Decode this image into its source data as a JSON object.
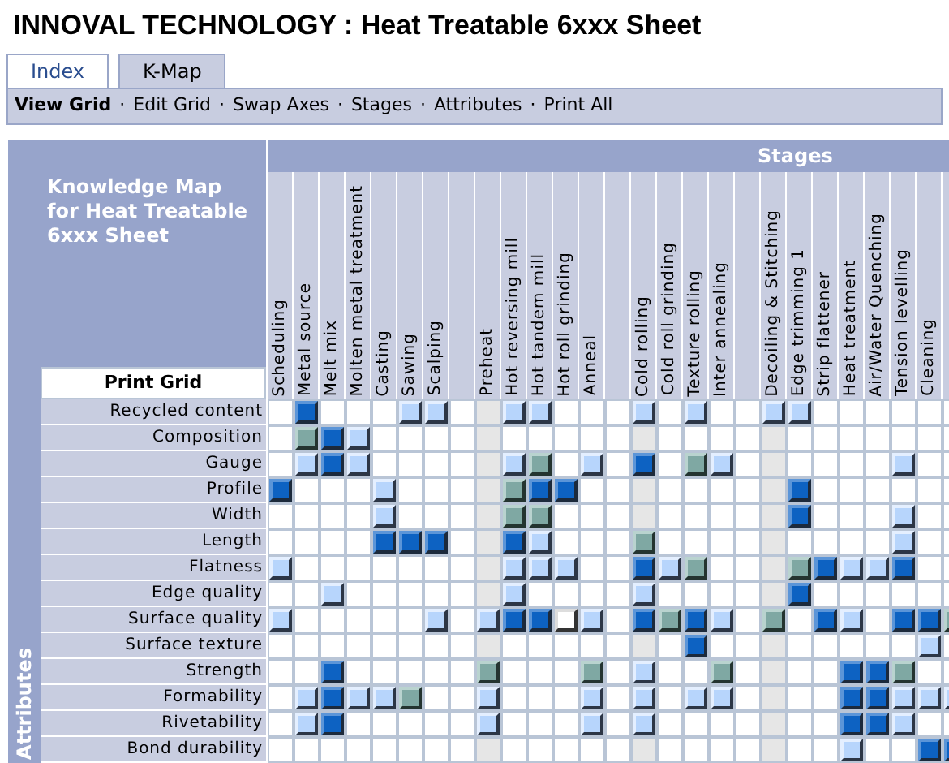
{
  "title": "INNOVAL TECHNOLOGY : Heat Treatable 6xxx Sheet",
  "tabs": [
    {
      "label": "Index",
      "selected": false
    },
    {
      "label": "K-Map",
      "selected": true
    }
  ],
  "toolbar": [
    {
      "label": "View Grid",
      "selected": true
    },
    {
      "label": "Edit Grid",
      "selected": false
    },
    {
      "label": "Swap Axes",
      "selected": false
    },
    {
      "label": "Stages",
      "selected": false
    },
    {
      "label": "Attributes",
      "selected": false
    },
    {
      "label": "Print All",
      "selected": false
    }
  ],
  "separator": "·",
  "grid_title": "Knowledge Map for Heat Treatable 6xxx Sheet",
  "stages_heading": "Stages",
  "attributes_heading": "Attributes",
  "print_button": "Print Grid",
  "columns": [
    {
      "label": "Scheduling",
      "shaded": false
    },
    {
      "label": "Metal source",
      "shaded": false
    },
    {
      "label": "Melt mix",
      "shaded": false
    },
    {
      "label": "Molten metal treatment",
      "shaded": false
    },
    {
      "label": "Casting",
      "shaded": false
    },
    {
      "label": "Sawing",
      "shaded": false
    },
    {
      "label": "Scalping",
      "shaded": false
    },
    {
      "shaded": false
    },
    {
      "label": "Preheat",
      "shaded": true
    },
    {
      "label": "Hot reversing mill",
      "shaded": false
    },
    {
      "label": "Hot tandem mill",
      "shaded": false
    },
    {
      "label": "Hot roll grinding",
      "shaded": false
    },
    {
      "label": "Anneal",
      "shaded": false
    },
    {
      "shaded": false
    },
    {
      "label": "Cold rolling",
      "shaded": true
    },
    {
      "label": "Cold roll grinding",
      "shaded": false
    },
    {
      "label": "Texture rolling",
      "shaded": false
    },
    {
      "label": "Inter annealing",
      "shaded": false
    },
    {
      "shaded": false
    },
    {
      "label": "Decoiling & Stitching",
      "shaded": true
    },
    {
      "label": "Edge trimming 1",
      "shaded": false
    },
    {
      "label": "Strip flattener",
      "shaded": false
    },
    {
      "label": "Heat treatment",
      "shaded": false
    },
    {
      "label": "Air/Water Quenching",
      "shaded": false
    },
    {
      "label": "Tension levelling",
      "shaded": false
    },
    {
      "label": "Cleaning",
      "shaded": false
    },
    {
      "shaded": false
    }
  ],
  "rows": [
    {
      "label": "Recycled content",
      "cells": [
        {
          "kind": "none"
        },
        {
          "kind": "dark"
        },
        {
          "kind": "none"
        },
        {
          "kind": "none"
        },
        {
          "kind": "none"
        },
        {
          "kind": "light"
        },
        {
          "kind": "light"
        },
        {
          "kind": "none"
        },
        {
          "kind": "none"
        },
        {
          "kind": "light"
        },
        {
          "kind": "light"
        },
        {
          "kind": "none"
        },
        {
          "kind": "none"
        },
        {
          "kind": "none"
        },
        {
          "kind": "light"
        },
        {
          "kind": "none"
        },
        {
          "kind": "light"
        },
        {
          "kind": "none"
        },
        {
          "kind": "none"
        },
        {
          "kind": "light"
        },
        {
          "kind": "light"
        },
        {
          "kind": "none"
        },
        {
          "kind": "none"
        },
        {
          "kind": "none"
        },
        {
          "kind": "none"
        },
        {
          "kind": "none"
        },
        {
          "kind": "none"
        }
      ]
    },
    {
      "label": "Composition",
      "cells": [
        {
          "kind": "none"
        },
        {
          "kind": "green"
        },
        {
          "kind": "dark"
        },
        {
          "kind": "light"
        },
        {
          "kind": "none"
        },
        {
          "kind": "none"
        },
        {
          "kind": "none"
        },
        {
          "kind": "none"
        },
        {
          "kind": "none"
        },
        {
          "kind": "none"
        },
        {
          "kind": "none"
        },
        {
          "kind": "none"
        },
        {
          "kind": "none"
        },
        {
          "kind": "none"
        },
        {
          "kind": "none"
        },
        {
          "kind": "none"
        },
        {
          "kind": "none"
        },
        {
          "kind": "none"
        },
        {
          "kind": "none"
        },
        {
          "kind": "none"
        },
        {
          "kind": "none"
        },
        {
          "kind": "none"
        },
        {
          "kind": "none"
        },
        {
          "kind": "none"
        },
        {
          "kind": "none"
        },
        {
          "kind": "none"
        },
        {
          "kind": "none"
        }
      ]
    },
    {
      "label": "Gauge",
      "cells": [
        {
          "kind": "none"
        },
        {
          "kind": "light"
        },
        {
          "kind": "dark"
        },
        {
          "kind": "light"
        },
        {
          "kind": "none"
        },
        {
          "kind": "none"
        },
        {
          "kind": "none"
        },
        {
          "kind": "none"
        },
        {
          "kind": "none"
        },
        {
          "kind": "light"
        },
        {
          "kind": "green"
        },
        {
          "kind": "none"
        },
        {
          "kind": "light"
        },
        {
          "kind": "none"
        },
        {
          "kind": "dark"
        },
        {
          "kind": "none"
        },
        {
          "kind": "green"
        },
        {
          "kind": "light"
        },
        {
          "kind": "none"
        },
        {
          "kind": "none"
        },
        {
          "kind": "none"
        },
        {
          "kind": "none"
        },
        {
          "kind": "none"
        },
        {
          "kind": "none"
        },
        {
          "kind": "light"
        },
        {
          "kind": "none"
        },
        {
          "kind": "none"
        }
      ]
    },
    {
      "label": "Profile",
      "cells": [
        {
          "kind": "dark"
        },
        {
          "kind": "none"
        },
        {
          "kind": "none"
        },
        {
          "kind": "none"
        },
        {
          "kind": "light"
        },
        {
          "kind": "none"
        },
        {
          "kind": "none"
        },
        {
          "kind": "none"
        },
        {
          "kind": "none"
        },
        {
          "kind": "green"
        },
        {
          "kind": "dark"
        },
        {
          "kind": "dark"
        },
        {
          "kind": "none"
        },
        {
          "kind": "none"
        },
        {
          "kind": "none"
        },
        {
          "kind": "none"
        },
        {
          "kind": "none"
        },
        {
          "kind": "none"
        },
        {
          "kind": "none"
        },
        {
          "kind": "none"
        },
        {
          "kind": "dark"
        },
        {
          "kind": "none"
        },
        {
          "kind": "none"
        },
        {
          "kind": "none"
        },
        {
          "kind": "none"
        },
        {
          "kind": "none"
        },
        {
          "kind": "none"
        }
      ]
    },
    {
      "label": "Width",
      "cells": [
        {
          "kind": "none"
        },
        {
          "kind": "none"
        },
        {
          "kind": "none"
        },
        {
          "kind": "none"
        },
        {
          "kind": "light"
        },
        {
          "kind": "none"
        },
        {
          "kind": "none"
        },
        {
          "kind": "none"
        },
        {
          "kind": "none"
        },
        {
          "kind": "green"
        },
        {
          "kind": "green"
        },
        {
          "kind": "none"
        },
        {
          "kind": "none"
        },
        {
          "kind": "none"
        },
        {
          "kind": "none"
        },
        {
          "kind": "none"
        },
        {
          "kind": "none"
        },
        {
          "kind": "none"
        },
        {
          "kind": "none"
        },
        {
          "kind": "none"
        },
        {
          "kind": "dark"
        },
        {
          "kind": "none"
        },
        {
          "kind": "none"
        },
        {
          "kind": "none"
        },
        {
          "kind": "light"
        },
        {
          "kind": "none"
        },
        {
          "kind": "none"
        }
      ]
    },
    {
      "label": "Length",
      "cells": [
        {
          "kind": "none"
        },
        {
          "kind": "none"
        },
        {
          "kind": "none"
        },
        {
          "kind": "none"
        },
        {
          "kind": "dark"
        },
        {
          "kind": "dark"
        },
        {
          "kind": "dark"
        },
        {
          "kind": "none"
        },
        {
          "kind": "none"
        },
        {
          "kind": "dark"
        },
        {
          "kind": "light"
        },
        {
          "kind": "none"
        },
        {
          "kind": "none"
        },
        {
          "kind": "none"
        },
        {
          "kind": "green"
        },
        {
          "kind": "none"
        },
        {
          "kind": "none"
        },
        {
          "kind": "none"
        },
        {
          "kind": "none"
        },
        {
          "kind": "none"
        },
        {
          "kind": "none"
        },
        {
          "kind": "none"
        },
        {
          "kind": "none"
        },
        {
          "kind": "none"
        },
        {
          "kind": "light"
        },
        {
          "kind": "none"
        },
        {
          "kind": "none"
        }
      ]
    },
    {
      "label": "Flatness",
      "cells": [
        {
          "kind": "light"
        },
        {
          "kind": "none"
        },
        {
          "kind": "none"
        },
        {
          "kind": "none"
        },
        {
          "kind": "none"
        },
        {
          "kind": "none"
        },
        {
          "kind": "none"
        },
        {
          "kind": "none"
        },
        {
          "kind": "none"
        },
        {
          "kind": "light"
        },
        {
          "kind": "light"
        },
        {
          "kind": "light"
        },
        {
          "kind": "none"
        },
        {
          "kind": "none"
        },
        {
          "kind": "dark"
        },
        {
          "kind": "light"
        },
        {
          "kind": "green"
        },
        {
          "kind": "none"
        },
        {
          "kind": "none"
        },
        {
          "kind": "none"
        },
        {
          "kind": "green"
        },
        {
          "kind": "dark"
        },
        {
          "kind": "light"
        },
        {
          "kind": "light"
        },
        {
          "kind": "dark"
        },
        {
          "kind": "none"
        },
        {
          "kind": "none"
        }
      ]
    },
    {
      "label": "Edge quality",
      "cells": [
        {
          "kind": "none"
        },
        {
          "kind": "none"
        },
        {
          "kind": "light"
        },
        {
          "kind": "none"
        },
        {
          "kind": "none"
        },
        {
          "kind": "none"
        },
        {
          "kind": "none"
        },
        {
          "kind": "none"
        },
        {
          "kind": "none"
        },
        {
          "kind": "light"
        },
        {
          "kind": "none"
        },
        {
          "kind": "none"
        },
        {
          "kind": "none"
        },
        {
          "kind": "none"
        },
        {
          "kind": "light"
        },
        {
          "kind": "none"
        },
        {
          "kind": "none"
        },
        {
          "kind": "none"
        },
        {
          "kind": "none"
        },
        {
          "kind": "none"
        },
        {
          "kind": "dark"
        },
        {
          "kind": "none"
        },
        {
          "kind": "none"
        },
        {
          "kind": "none"
        },
        {
          "kind": "none"
        },
        {
          "kind": "none"
        },
        {
          "kind": "none"
        }
      ]
    },
    {
      "label": "Surface quality",
      "cells": [
        {
          "kind": "light"
        },
        {
          "kind": "none"
        },
        {
          "kind": "none"
        },
        {
          "kind": "none"
        },
        {
          "kind": "none"
        },
        {
          "kind": "none"
        },
        {
          "kind": "light"
        },
        {
          "kind": "none"
        },
        {
          "kind": "light"
        },
        {
          "kind": "dark"
        },
        {
          "kind": "dark"
        },
        {
          "kind": "white"
        },
        {
          "kind": "light"
        },
        {
          "kind": "none"
        },
        {
          "kind": "dark"
        },
        {
          "kind": "green"
        },
        {
          "kind": "dark"
        },
        {
          "kind": "light"
        },
        {
          "kind": "none"
        },
        {
          "kind": "green"
        },
        {
          "kind": "none"
        },
        {
          "kind": "dark"
        },
        {
          "kind": "light"
        },
        {
          "kind": "none"
        },
        {
          "kind": "dark"
        },
        {
          "kind": "dark"
        },
        {
          "kind": "green"
        }
      ]
    },
    {
      "label": "Surface texture",
      "cells": [
        {
          "kind": "none"
        },
        {
          "kind": "none"
        },
        {
          "kind": "none"
        },
        {
          "kind": "none"
        },
        {
          "kind": "none"
        },
        {
          "kind": "none"
        },
        {
          "kind": "none"
        },
        {
          "kind": "none"
        },
        {
          "kind": "none"
        },
        {
          "kind": "none"
        },
        {
          "kind": "none"
        },
        {
          "kind": "none"
        },
        {
          "kind": "none"
        },
        {
          "kind": "none"
        },
        {
          "kind": "none"
        },
        {
          "kind": "none"
        },
        {
          "kind": "dark"
        },
        {
          "kind": "none"
        },
        {
          "kind": "none"
        },
        {
          "kind": "none"
        },
        {
          "kind": "none"
        },
        {
          "kind": "none"
        },
        {
          "kind": "none"
        },
        {
          "kind": "none"
        },
        {
          "kind": "none"
        },
        {
          "kind": "light"
        },
        {
          "kind": "none"
        }
      ]
    },
    {
      "label": "Strength",
      "cells": [
        {
          "kind": "none"
        },
        {
          "kind": "none"
        },
        {
          "kind": "dark"
        },
        {
          "kind": "none"
        },
        {
          "kind": "none"
        },
        {
          "kind": "none"
        },
        {
          "kind": "none"
        },
        {
          "kind": "none"
        },
        {
          "kind": "green"
        },
        {
          "kind": "none"
        },
        {
          "kind": "none"
        },
        {
          "kind": "none"
        },
        {
          "kind": "green"
        },
        {
          "kind": "none"
        },
        {
          "kind": "light"
        },
        {
          "kind": "none"
        },
        {
          "kind": "none"
        },
        {
          "kind": "green"
        },
        {
          "kind": "none"
        },
        {
          "kind": "none"
        },
        {
          "kind": "none"
        },
        {
          "kind": "none"
        },
        {
          "kind": "dark"
        },
        {
          "kind": "dark"
        },
        {
          "kind": "green"
        },
        {
          "kind": "none"
        },
        {
          "kind": "none"
        }
      ]
    },
    {
      "label": "Formability",
      "cells": [
        {
          "kind": "none"
        },
        {
          "kind": "light"
        },
        {
          "kind": "dark"
        },
        {
          "kind": "light"
        },
        {
          "kind": "light"
        },
        {
          "kind": "green"
        },
        {
          "kind": "none"
        },
        {
          "kind": "none"
        },
        {
          "kind": "light"
        },
        {
          "kind": "none"
        },
        {
          "kind": "none"
        },
        {
          "kind": "none"
        },
        {
          "kind": "light"
        },
        {
          "kind": "none"
        },
        {
          "kind": "light"
        },
        {
          "kind": "none"
        },
        {
          "kind": "light"
        },
        {
          "kind": "light"
        },
        {
          "kind": "none"
        },
        {
          "kind": "none"
        },
        {
          "kind": "none"
        },
        {
          "kind": "none"
        },
        {
          "kind": "dark"
        },
        {
          "kind": "dark"
        },
        {
          "kind": "light"
        },
        {
          "kind": "light"
        },
        {
          "kind": "light"
        }
      ]
    },
    {
      "label": "Rivetability",
      "cells": [
        {
          "kind": "none"
        },
        {
          "kind": "light"
        },
        {
          "kind": "dark"
        },
        {
          "kind": "none"
        },
        {
          "kind": "none"
        },
        {
          "kind": "none"
        },
        {
          "kind": "none"
        },
        {
          "kind": "none"
        },
        {
          "kind": "light"
        },
        {
          "kind": "none"
        },
        {
          "kind": "none"
        },
        {
          "kind": "none"
        },
        {
          "kind": "light"
        },
        {
          "kind": "none"
        },
        {
          "kind": "light"
        },
        {
          "kind": "none"
        },
        {
          "kind": "none"
        },
        {
          "kind": "none"
        },
        {
          "kind": "none"
        },
        {
          "kind": "none"
        },
        {
          "kind": "none"
        },
        {
          "kind": "none"
        },
        {
          "kind": "dark"
        },
        {
          "kind": "dark"
        },
        {
          "kind": "light"
        },
        {
          "kind": "none"
        },
        {
          "kind": "none"
        }
      ]
    },
    {
      "label": "Bond durability",
      "cells": [
        {
          "kind": "none"
        },
        {
          "kind": "none"
        },
        {
          "kind": "none"
        },
        {
          "kind": "none"
        },
        {
          "kind": "none"
        },
        {
          "kind": "none"
        },
        {
          "kind": "none"
        },
        {
          "kind": "none"
        },
        {
          "kind": "none"
        },
        {
          "kind": "none"
        },
        {
          "kind": "none"
        },
        {
          "kind": "none"
        },
        {
          "kind": "none"
        },
        {
          "kind": "none"
        },
        {
          "kind": "none"
        },
        {
          "kind": "none"
        },
        {
          "kind": "none"
        },
        {
          "kind": "none"
        },
        {
          "kind": "none"
        },
        {
          "kind": "none"
        },
        {
          "kind": "none"
        },
        {
          "kind": "none"
        },
        {
          "kind": "light"
        },
        {
          "kind": "none"
        },
        {
          "kind": "none"
        },
        {
          "kind": "dark"
        },
        {
          "kind": "dark"
        }
      ]
    }
  ]
}
